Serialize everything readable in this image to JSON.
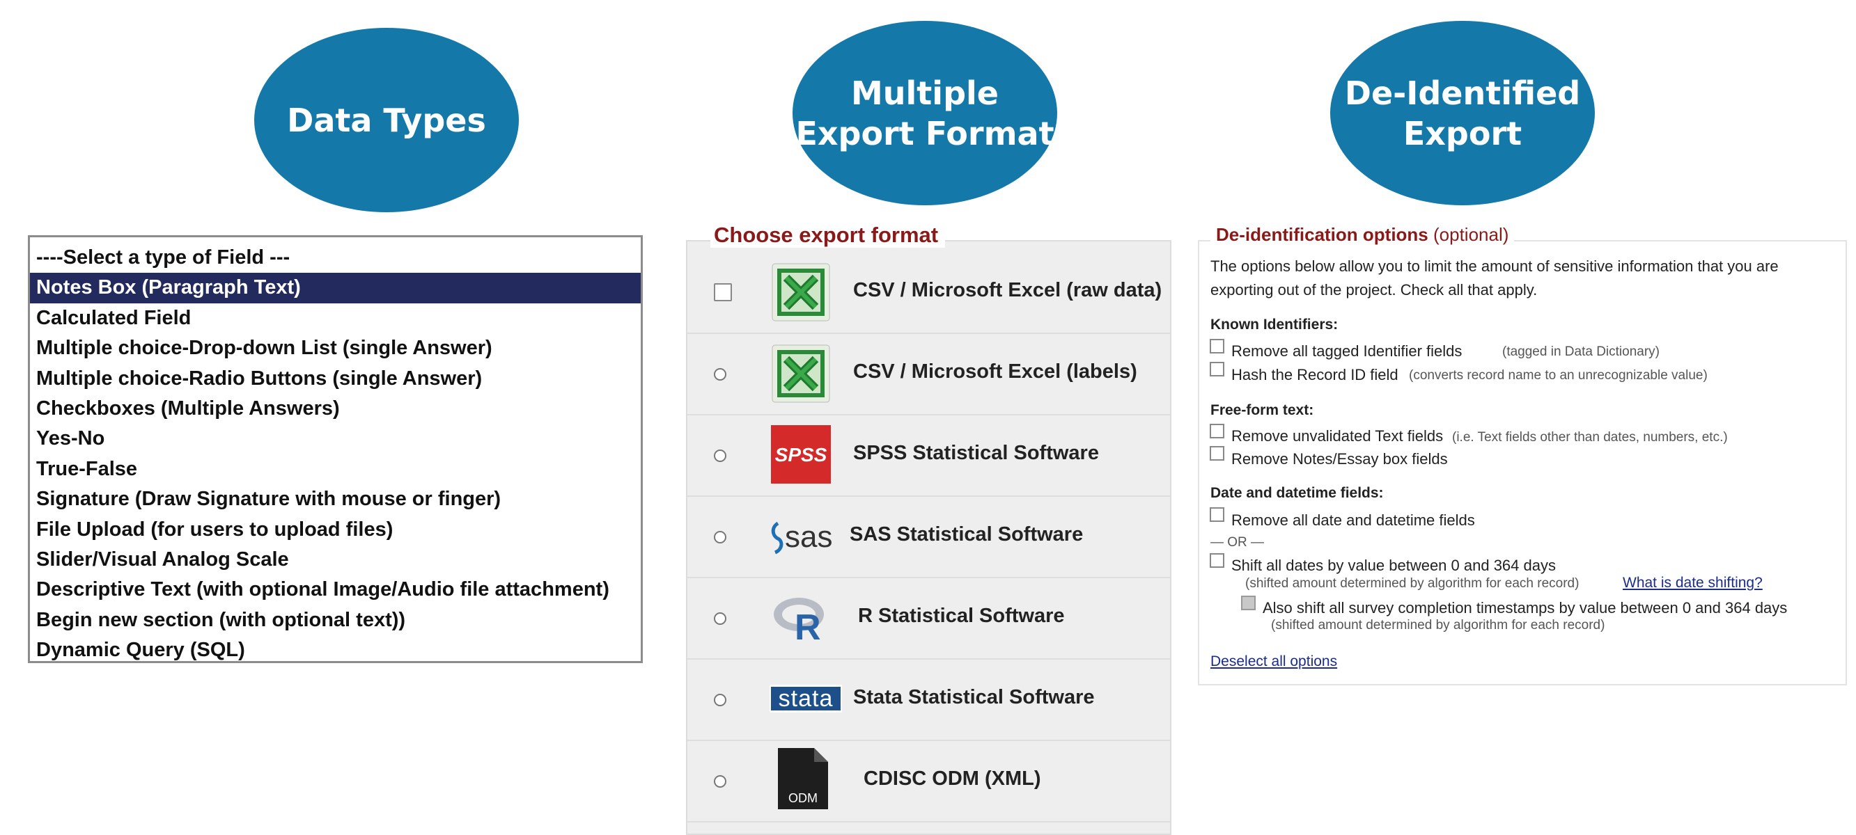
{
  "ovals": {
    "data_types": "Data Types",
    "multiple_export": "Multiple\nExport Format",
    "deidentified": "De-Identified\nExport"
  },
  "field_types": {
    "items": [
      "----Select a type of Field ---",
      "Notes Box (Paragraph Text)",
      "Calculated Field",
      "Multiple choice-Drop-down List (single Answer)",
      "Multiple choice-Radio Buttons (single Answer)",
      "Checkboxes (Multiple Answers)",
      "Yes-No",
      "True-False",
      "Signature (Draw Signature with mouse or finger)",
      "File Upload (for users to upload files)",
      "Slider/Visual Analog Scale",
      "Descriptive Text (with optional Image/Audio file attachment)",
      "Begin new section (with optional text))",
      "Dynamic Query (SQL)"
    ],
    "selected_index": 1
  },
  "export": {
    "title": "Choose export format",
    "options": [
      {
        "label": "CSV / Microsoft Excel (raw data)",
        "icon": "excel-icon"
      },
      {
        "label": "CSV / Microsoft Excel (labels)",
        "icon": "excel-icon"
      },
      {
        "label": "SPSS Statistical Software",
        "icon": "spss-logo",
        "logo_text": "SPSS"
      },
      {
        "label": "SAS Statistical Software",
        "icon": "sas-logo",
        "logo_text": "sas"
      },
      {
        "label": "R Statistical Software",
        "icon": "r-logo",
        "logo_text": "R"
      },
      {
        "label": "Stata Statistical Software",
        "icon": "stata-logo",
        "logo_text": "stata"
      },
      {
        "label": "CDISC ODM (XML)",
        "icon": "odm-file-icon",
        "logo_text": "ODM"
      }
    ]
  },
  "deid": {
    "title": "De-identification options",
    "title_note": "(optional)",
    "intro_line1": "The options below allow you to limit the amount of sensitive information that you are",
    "intro_line2": "exporting out of the project. Check all that apply.",
    "known_identifiers": "Known Identifiers:",
    "remove_tagged": "Remove all tagged Identifier fields",
    "remove_tagged_note": "(tagged in Data Dictionary)",
    "hash_record": "Hash the Record ID field",
    "hash_record_note": "(converts record name to an unrecognizable value)",
    "free_form": "Free-form text:",
    "remove_unvalidated": "Remove unvalidated Text fields",
    "remove_unvalidated_note": "(i.e. Text fields other than dates, numbers, etc.)",
    "remove_notes": "Remove Notes/Essay box fields",
    "date_fields": "Date and datetime fields:",
    "remove_dates": "Remove all date and datetime fields",
    "or_divider": "— OR —",
    "shift_dates": "Shift all dates by value between 0 and 364 days",
    "shift_dates_note": "(shifted amount determined by algorithm for each record)",
    "what_is_shifting": "What is date shifting?",
    "shift_timestamps": "Also shift all survey completion timestamps by value between 0 and 364 days",
    "shift_timestamps_note": "(shifted amount determined by algorithm for each record)",
    "deselect_all": "Deselect all options"
  }
}
